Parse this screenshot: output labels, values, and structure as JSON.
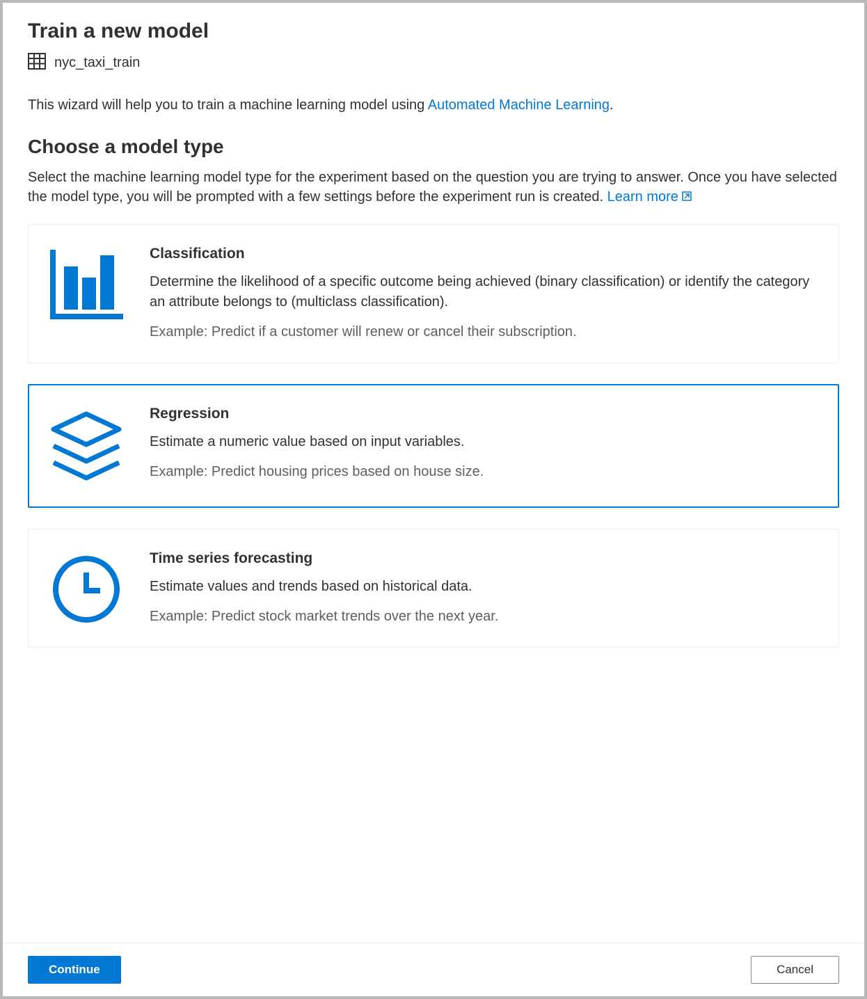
{
  "header": {
    "title": "Train a new model",
    "dataset_name": "nyc_taxi_train"
  },
  "intro": {
    "text_before": "This wizard will help you to train a machine learning model using ",
    "link_text": "Automated Machine Learning",
    "text_after": "."
  },
  "section": {
    "title": "Choose a model type",
    "description": "Select the machine learning model type for the experiment based on the question you are trying to answer. Once you have selected the model type, you will be prompted with a few settings before the experiment run is created. ",
    "learn_more": "Learn more"
  },
  "cards": [
    {
      "id": "classification",
      "title": "Classification",
      "description": "Determine the likelihood of a specific outcome being achieved (binary classification) or identify the category an attribute belongs to (multiclass classification).",
      "example": "Example: Predict if a customer will renew or cancel their subscription.",
      "selected": false
    },
    {
      "id": "regression",
      "title": "Regression",
      "description": "Estimate a numeric value based on input variables.",
      "example": "Example: Predict housing prices based on house size.",
      "selected": true
    },
    {
      "id": "timeseries",
      "title": "Time series forecasting",
      "description": "Estimate values and trends based on historical data.",
      "example": "Example: Predict stock market trends over the next year.",
      "selected": false
    }
  ],
  "footer": {
    "continue_label": "Continue",
    "cancel_label": "Cancel"
  }
}
